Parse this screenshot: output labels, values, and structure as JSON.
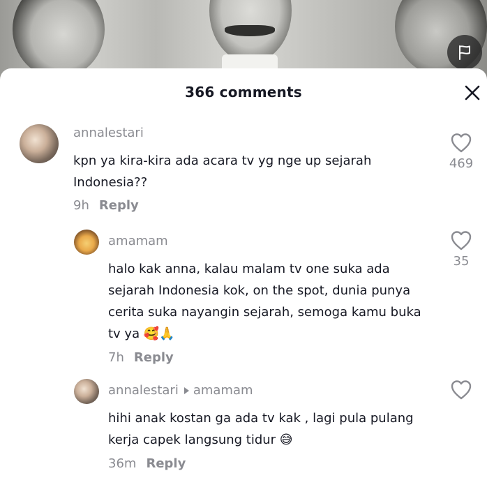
{
  "sheet": {
    "title": "366 comments"
  },
  "comments": [
    {
      "username": "annalestari",
      "text_lines": [
        "kpn ya kira-kira ada acara tv yg nge up sejarah",
        "Indonesia??"
      ],
      "time": "9h",
      "reply_label": "Reply",
      "likes": "469"
    },
    {
      "username": "amamam",
      "text_lines": [
        "halo kak anna, kalau malam tv one suka ada",
        "sejarah Indonesia kok, on the spot, dunia punya",
        "cerita suka nayangin sejarah, semoga kamu buka",
        "tv ya 🥰🙏"
      ],
      "time": "7h",
      "reply_label": "Reply",
      "likes": "35"
    },
    {
      "username": "annalestari",
      "reply_to": "amamam",
      "text_lines": [
        "hihi anak kostan ga ada tv kak , lagi pula pulang",
        "kerja capek langsung tidur 😅"
      ],
      "time": "36m",
      "reply_label": "Reply",
      "likes": ""
    }
  ],
  "icons": {
    "flag": "flag-icon",
    "close": "close-icon",
    "heart": "heart-outline-icon"
  },
  "colors": {
    "text_primary": "#161823",
    "text_secondary": "#8a8b91"
  }
}
